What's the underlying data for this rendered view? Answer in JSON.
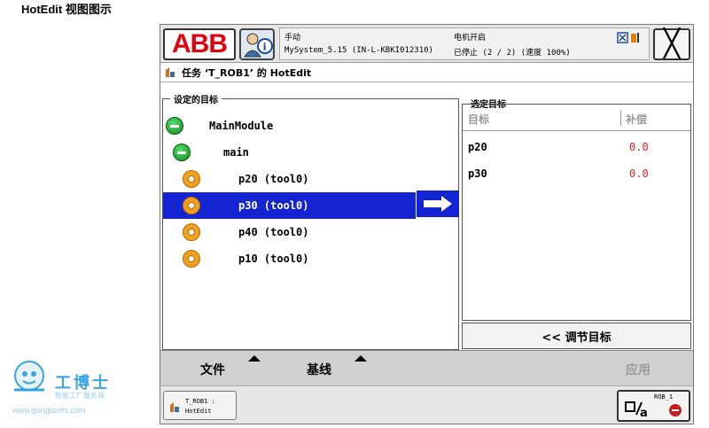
{
  "page_heading": "HotEdit 视图图示",
  "topbar": {
    "logo_text": "ABB",
    "status_mode": "手动",
    "status_system": "MySystem_5.15 (IN-L-KBKI012310)",
    "status_motors": "电机开启",
    "status_state": "已停止 (2 / 2) (速度 100%)",
    "close_symbol": "╳"
  },
  "titlebar": {
    "title": "任务 ‘T_ROB1’ 的 HotEdit"
  },
  "left_pane": {
    "group_label": "设定的目标",
    "tree": [
      {
        "label": "MainModule",
        "icon": "module-collapse-icon"
      },
      {
        "label": "main",
        "icon": "routine-collapse-icon"
      },
      {
        "label": "p20 (tool0)",
        "icon": "target-icon"
      },
      {
        "label": "p30 (tool0)",
        "icon": "target-icon"
      },
      {
        "label": "p40 (tool0)",
        "icon": "target-icon"
      },
      {
        "label": "p10 (tool0)",
        "icon": "target-icon"
      }
    ],
    "selected_index": 3
  },
  "right_pane": {
    "group_label": "选定目标",
    "col_target": "目标",
    "col_offset": "补偿",
    "rows": [
      {
        "name": "p20",
        "value": "0.0"
      },
      {
        "name": "p30",
        "value": "0.0"
      }
    ],
    "tune_button": "<< 调节目标"
  },
  "bottom_menu": {
    "file": "文件",
    "baseline": "基线",
    "apply": "应用"
  },
  "taskbar": {
    "task_line1": "T_ROB1 :",
    "task_line2": "HotEdit",
    "rob_label": "ROB_1"
  },
  "watermark": {
    "name": "工博士",
    "sub": "智能工厂服务商",
    "url": "www.gongboshi.com"
  },
  "colors": {
    "selection": "#1424d0",
    "abb_red": "#e2000f",
    "offset_value": "#d22222"
  }
}
